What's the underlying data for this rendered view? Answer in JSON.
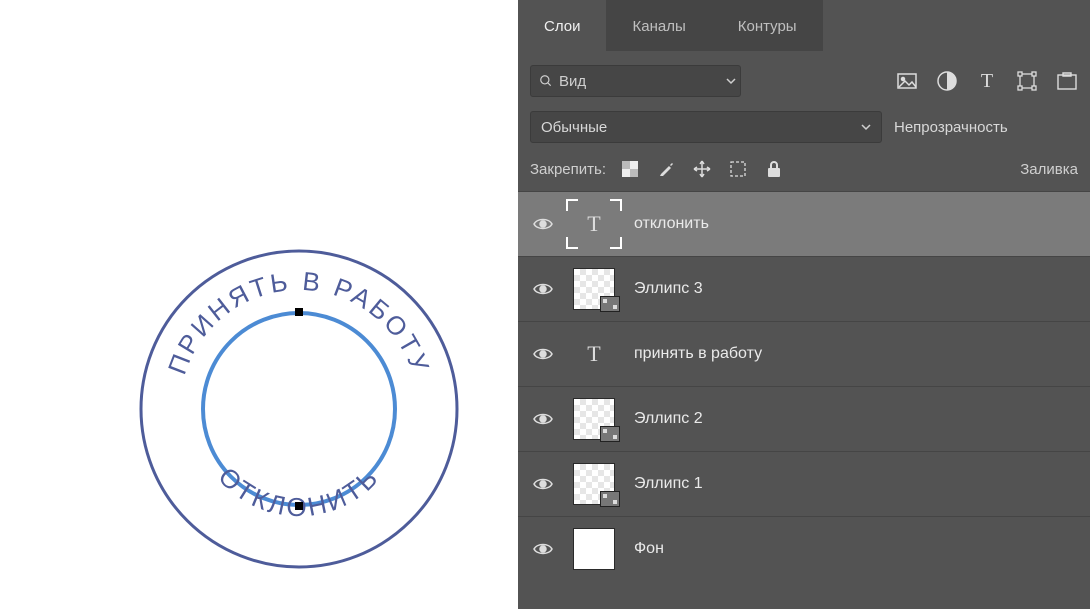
{
  "tabs": {
    "layers": "Слои",
    "channels": "Каналы",
    "paths": "Контуры"
  },
  "search": {
    "placeholder": "Вид"
  },
  "blend": {
    "mode": "Обычные",
    "opacity_label": "Непрозрачность"
  },
  "lock": {
    "label": "Закрепить:",
    "fill_label": "Заливка"
  },
  "filterIcons": {
    "image": "image-icon",
    "adjust": "adjust-icon",
    "text": "text-type-icon",
    "shape": "shape-transform-icon",
    "smart": "smart-object-icon"
  },
  "stamp": {
    "top_text": "ПРИНЯТЬ В РАБОТУ",
    "bottom_text": "ОТКЛОНИТЬ"
  },
  "layers": [
    {
      "name": "отклонить",
      "type": "text",
      "selected": true
    },
    {
      "name": "Эллипс 3",
      "type": "shape"
    },
    {
      "name": "принять в работу",
      "type": "text-plain"
    },
    {
      "name": "Эллипс 2",
      "type": "shape"
    },
    {
      "name": "Эллипс 1",
      "type": "shape"
    },
    {
      "name": "Фон",
      "type": "bg"
    }
  ]
}
